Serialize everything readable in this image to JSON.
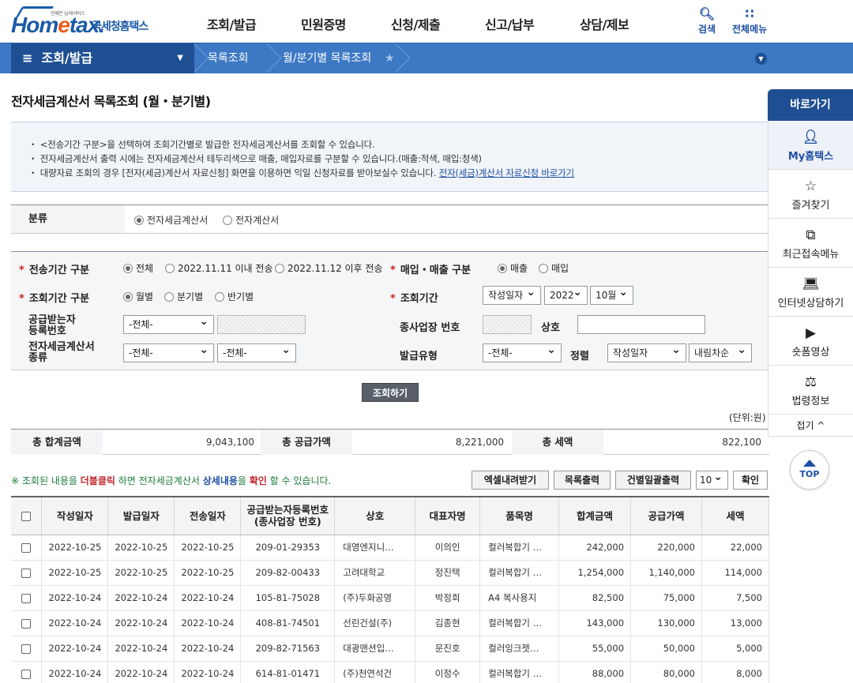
{
  "header": {
    "logo_small": "언제든 납세서비스",
    "logo_text_a": "Hom",
    "logo_text_e": "e",
    "logo_text_b": "tax.",
    "logo_kr": "국세청홈택스",
    "nav": [
      "조회/발급",
      "민원증명",
      "신청/제출",
      "신고/납부",
      "상담/제보"
    ],
    "search_label": "검색",
    "allmenu_label": "전체메뉴"
  },
  "subnav": {
    "menu": "조회/발급",
    "crumb1": "목록조회",
    "crumb2": "월/분기별 목록조회"
  },
  "page_title": "전자세금계산서 목록조회 (월・분기별)",
  "notice": {
    "line1": "<전송기간 구분>을 선택하여 조회기간별로 발급한 전자세금계산서를 조회할 수 있습니다.",
    "line2": "전자세금계산서 출력 시에는 전자세금계산서 테두리색으로 매출, 매입자료를 구분할 수 있습니다.(매출:적색, 매입:청색)",
    "line3": "대량자료 조회의 경우 [전자(세금)계산서 자료신청] 화면을 이용하면 익일 신청자료를 받아보실수 있습니다.",
    "link": "전자(세금)계산서 자료신청 바로가기"
  },
  "classification": {
    "label": "분류",
    "opt1": "전자세금계산서",
    "opt2": "전자계산서"
  },
  "search": {
    "period_label": "전송기간 구분",
    "period_opts": [
      "전체",
      "2022.11.11 이내 전송",
      "2022.11.12 이후 전송"
    ],
    "sales_label": "매입・매출 구분",
    "sales_opts": [
      "매출",
      "매입"
    ],
    "query_period_label": "조회기간 구분",
    "query_period_opts": [
      "월별",
      "분기별",
      "반기별"
    ],
    "query_label": "조회기간",
    "date_type": "작성일자",
    "year": "2022",
    "month": "10월",
    "receiver_label_1": "공급받는자",
    "receiver_label_2": "등록번호",
    "receiver_select": "-전체-",
    "branch_label": "종사업장 번호",
    "company_label": "상호",
    "kind_label_1": "전자세금계산서",
    "kind_label_2": "종류",
    "kind_select1": "-전체-",
    "kind_select2": "-전체-",
    "issue_type_label": "발급유형",
    "issue_type_select": "-전체-",
    "sort_label": "정렬",
    "sort_select": "작성일자",
    "sort_order": "내림차순",
    "button": "조회하기"
  },
  "unit": "(단위:원)",
  "summary": {
    "total_label": "총 합계금액",
    "total_value": "9,043,100",
    "supply_label": "총 공급가액",
    "supply_value": "8,221,000",
    "tax_label": "총 세액",
    "tax_value": "822,100"
  },
  "info": {
    "pre": "※ 조회된 내용을 ",
    "dbl": "더블클릭",
    "mid": " 하면 전자세금계산서 ",
    "detail": "상세내용",
    "mid2": "을 ",
    "confirm": "확인",
    "post": " 할 수 있습니다."
  },
  "toolbar": {
    "excel": "엑셀내려받기",
    "print": "목록출력",
    "bulk": "건별일괄출력",
    "pagesize": "10",
    "ok": "확인"
  },
  "table": {
    "headers": [
      "작성일자",
      "발급일자",
      "전송일자",
      "공급받는자등록번호",
      "(종사업장 번호)",
      "상호",
      "대표자명",
      "품목명",
      "합계금액",
      "공급가액",
      "세액"
    ],
    "rows": [
      [
        "2022-10-25",
        "2022-10-25",
        "2022-10-25",
        "209-01-29353",
        "대영엔지니…",
        "이의인",
        "컬러복합기 …",
        "242,000",
        "220,000",
        "22,000"
      ],
      [
        "2022-10-25",
        "2022-10-25",
        "2022-10-25",
        "209-82-00433",
        "고려대학교",
        "정진택",
        "컬러복합기 …",
        "1,254,000",
        "1,140,000",
        "114,000"
      ],
      [
        "2022-10-24",
        "2022-10-24",
        "2022-10-24",
        "105-81-75028",
        "(주)두화공영",
        "박정희",
        "A4 복사용지",
        "82,500",
        "75,000",
        "7,500"
      ],
      [
        "2022-10-24",
        "2022-10-24",
        "2022-10-24",
        "408-81-74501",
        "선린건설(주)",
        "김종현",
        "컬러복합기 …",
        "143,000",
        "130,000",
        "13,000"
      ],
      [
        "2022-10-24",
        "2022-10-24",
        "2022-10-24",
        "209-82-71563",
        "대광맨션입…",
        "문진호",
        "컬러잉크젯…",
        "55,000",
        "50,000",
        "5,000"
      ],
      [
        "2022-10-24",
        "2022-10-24",
        "2022-10-24",
        "614-81-01471",
        "(주)천연석건",
        "이정수",
        "컬러복합기 …",
        "88,000",
        "80,000",
        "8,000"
      ]
    ]
  },
  "quicknav": {
    "title": "바로가기",
    "items": [
      "My홈택스",
      "즐겨찾기",
      "최근접속메뉴",
      "인터넷상담하기",
      "숏폼영상",
      "법령정보"
    ],
    "fold": "접기 ^",
    "top": "TOP"
  },
  "icons": [
    "search-icon",
    "grid-menu-icon",
    "user-icon",
    "star-icon",
    "recent-icon",
    "laptop-icon",
    "play-icon",
    "gavel-icon",
    "arrow-up-icon",
    "chevron-down-icon"
  ],
  "colors": {
    "brand": "#1f4f93",
    "subnav": "#3c78c3",
    "accent_orange": "#e85d1c",
    "info_green": "#1a7b3c",
    "info_red": "#c0282e"
  }
}
